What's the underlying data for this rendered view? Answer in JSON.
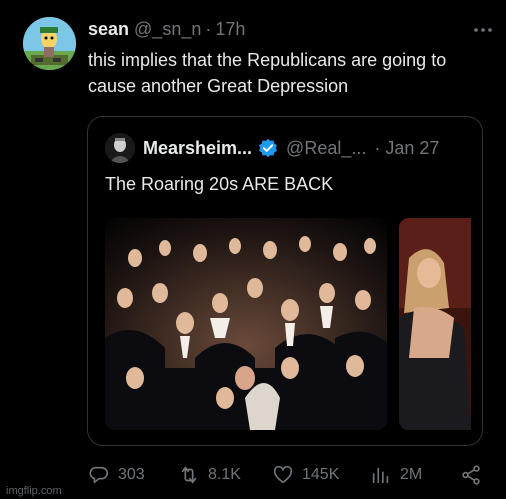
{
  "tweet": {
    "display_name": "sean",
    "handle": "@_sn_n",
    "separator": "·",
    "time": "17h",
    "text": "this implies that the Republicans are going to cause another Great Depression",
    "avatar_icon": "cartoon-avatar-icon",
    "more_icon": "more-dots-icon"
  },
  "quote": {
    "display_name": "Mearsheim...",
    "handle": "@Real_...",
    "separator": "·",
    "date": "Jan 27",
    "text": "The Roaring 20s ARE BACK",
    "verified_icon": "verified-badge-icon",
    "verified_color": "#1d9bf0",
    "images": [
      "party-crowd-photo",
      "party-woman-photo"
    ]
  },
  "actions": {
    "replies": "303",
    "reposts": "8.1K",
    "likes": "145K",
    "views": "2M",
    "reply_icon": "reply-icon",
    "repost_icon": "repost-icon",
    "like_icon": "heart-icon",
    "views_icon": "views-chart-icon",
    "share_icon": "share-icon"
  },
  "watermark": "imgflip.com"
}
